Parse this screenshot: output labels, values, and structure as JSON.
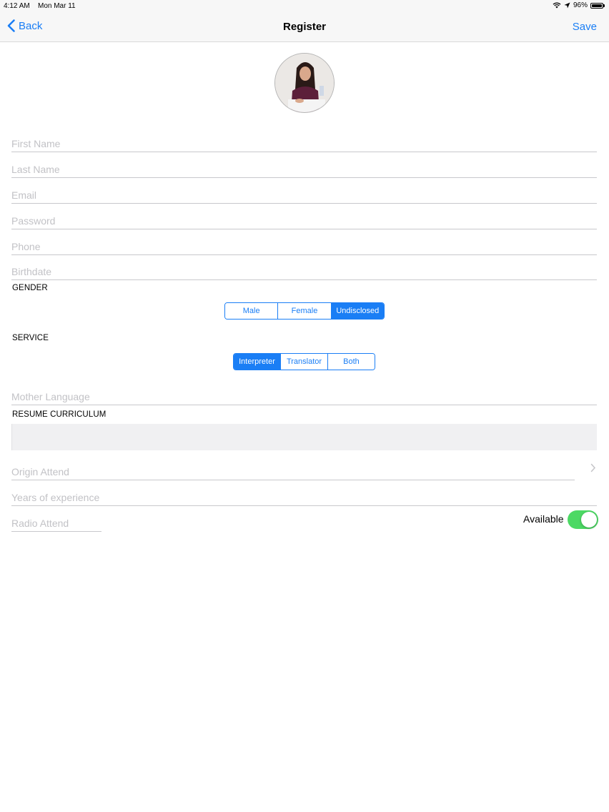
{
  "status_bar": {
    "time": "4:12 AM",
    "date": "Mon Mar 11",
    "battery": "96%"
  },
  "nav": {
    "back_label": "Back",
    "title": "Register",
    "save_label": "Save"
  },
  "form": {
    "first_name_placeholder": "First Name",
    "last_name_placeholder": "Last Name",
    "email_placeholder": "Email",
    "password_placeholder": "Password",
    "phone_placeholder": "Phone",
    "birthdate_placeholder": "Birthdate",
    "gender": {
      "label": "GENDER",
      "options": [
        "Male",
        "Female",
        "Undisclosed"
      ],
      "selected": "Undisclosed"
    },
    "service": {
      "label": "SERVICE",
      "options": [
        "Interpreter",
        "Translator",
        "Both"
      ],
      "selected": "Interpreter"
    },
    "mother_language_placeholder": "Mother Language",
    "resume_label": "RESUME CURRICULUM",
    "origin_attend_placeholder": "Origin Attend",
    "years_experience_placeholder": "Years of experience",
    "radio_attend_placeholder": "Radio Attend",
    "available_label": "Available",
    "available_on": true
  },
  "colors": {
    "accent": "#1a7ef5",
    "toggle_on": "#4cd964"
  }
}
